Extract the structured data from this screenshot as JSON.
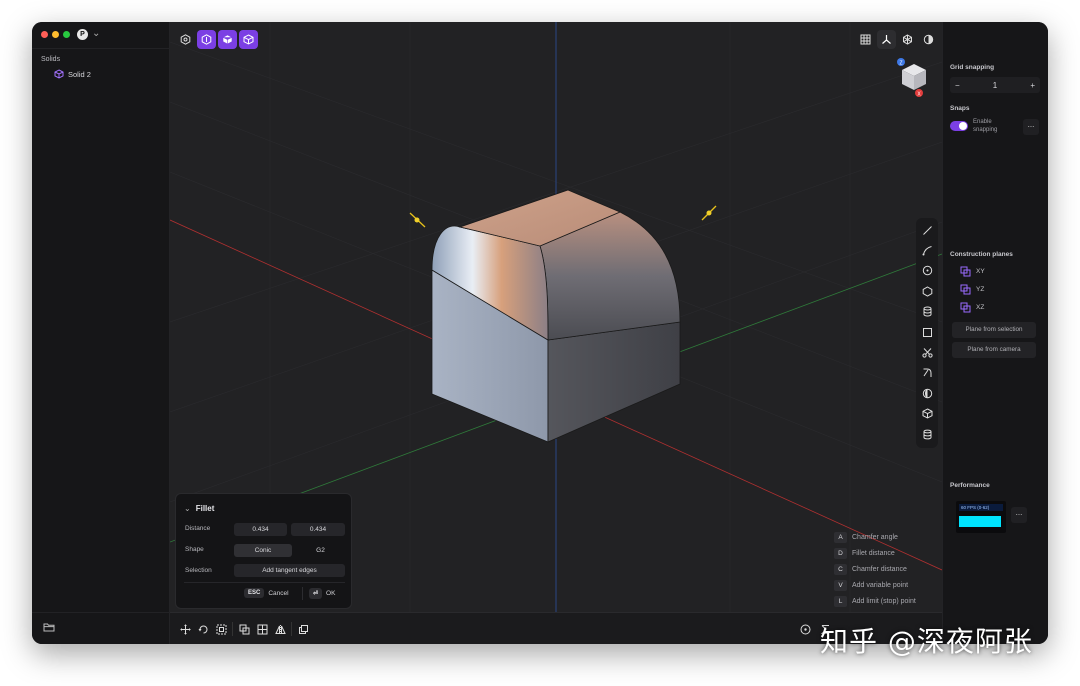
{
  "app": {
    "avatar_initial": "P",
    "traffic_colors": [
      "#ff5f57",
      "#febc2e",
      "#28c840"
    ]
  },
  "sidebar": {
    "section_label": "Solids",
    "items": [
      {
        "label": "Solid 2",
        "icon": "cube-icon"
      }
    ]
  },
  "toolbar": {
    "left_icons": [
      "settings-hex-icon",
      "solid-mode-icon",
      "box-icon",
      "body-icon"
    ],
    "right_icons": [
      "grid-icon",
      "axes-icon",
      "snowflake-icon",
      "theme-icon"
    ]
  },
  "viewcube": {
    "axis_top": "Z",
    "axis_bottom": "X"
  },
  "side_tools": [
    "line-icon",
    "arc-icon",
    "circle-icon",
    "polygon-icon",
    "cylinder-icon",
    "rectangle-icon",
    "scissors-icon",
    "fillet-tool-icon",
    "sphere-icon",
    "cube-tool-icon",
    "database-icon"
  ],
  "fillet_panel": {
    "title": "Fillet",
    "distance_label": "Distance",
    "distance_a": "0.434",
    "distance_b": "0.434",
    "shape_label": "Shape",
    "shape_a": "Conic",
    "shape_b": "G2",
    "selection_label": "Selection",
    "selection_btn": "Add tangent edges",
    "esc_key": "ESC",
    "cancel_label": "Cancel",
    "ok_key": "⏎",
    "ok_label": "OK"
  },
  "hints": [
    {
      "key": "A",
      "label": "Chamfer angle"
    },
    {
      "key": "D",
      "label": "Fillet distance"
    },
    {
      "key": "C",
      "label": "Chamfer distance"
    },
    {
      "key": "V",
      "label": "Add variable point"
    },
    {
      "key": "L",
      "label": "Add limit (stop) point"
    }
  ],
  "right_panel": {
    "grid_snapping_label": "Grid snapping",
    "grid_value": "1",
    "minus": "−",
    "plus": "+",
    "snaps_label": "Snaps",
    "enable_snapping": "Enable snapping",
    "more": "...",
    "construction_planes_label": "Construction planes",
    "planes": [
      "XY",
      "YZ",
      "XZ"
    ],
    "plane_from_selection": "Plane from selection",
    "plane_from_camera": "Plane from camera",
    "performance_label": "Performance",
    "fps_text": "60 FPS (0-62)"
  },
  "watermark": "知乎 @深夜阿张",
  "colors": {
    "accent": "#7b3fe4",
    "x_axis": "#b03030",
    "y_axis": "#2f7a3a",
    "z_axis": "#2c4f9c"
  }
}
